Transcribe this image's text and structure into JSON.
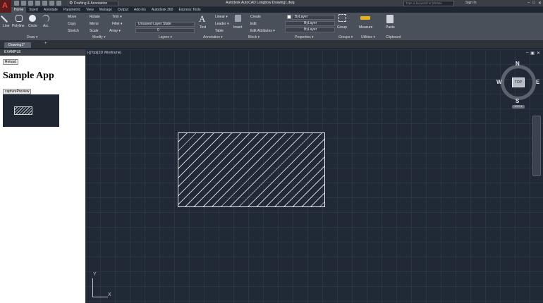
{
  "title_bar": {
    "workspace": "Drafting & Annotation",
    "title": "Autodesk AutoCAD Longbow   Drawing1.dwg",
    "search_placeholder": "Type a keyword or phrase",
    "sign_in": "Sign In"
  },
  "ribbon_tabs": [
    "Home",
    "Insert",
    "Annotate",
    "Parametric",
    "View",
    "Manage",
    "Output",
    "Add-ins",
    "Autodesk 360",
    "Express Tools"
  ],
  "ribbon": {
    "draw": {
      "line": "Line",
      "polyline": "Polyline",
      "circle": "Circle",
      "arc": "Arc",
      "panel": "Draw ▾"
    },
    "modify": {
      "move": "Move",
      "rotate": "Rotate",
      "trim": "Trim ▾",
      "copy": "Copy",
      "mirror": "Mirror",
      "fillet": "Fillet ▾",
      "stretch": "Stretch",
      "scale": "Scale",
      "array": "Array ▾",
      "panel": "Modify ▾"
    },
    "layers": {
      "layer_state": "Unsaved Layer State",
      "current_layer": "0",
      "panel": "Layers ▾"
    },
    "annotation": {
      "text": "Text",
      "linear": "Linear ▾",
      "leader": "Leader ▾",
      "table": "Table",
      "panel": "Annotation ▾"
    },
    "block": {
      "insert": "Insert",
      "create": "Create",
      "edit": "Edit",
      "edit_attributes": "Edit Attributes ▾",
      "panel": "Block ▾"
    },
    "properties": {
      "color": "ByLayer",
      "linetype": "ByLayer",
      "lineweight": "ByLayer",
      "panel": "Properties ▾"
    },
    "groups": {
      "group": "Group",
      "panel": "Groups ▾"
    },
    "utilities": {
      "measure": "Measure",
      "panel": "Utilities ▾"
    },
    "clipboard": {
      "paste": "Paste",
      "panel": "Clipboard"
    }
  },
  "doc_tab": "Drawing1*",
  "palette": {
    "header": "EXAMPLE",
    "reload": "Reload",
    "title": "Sample App",
    "capture": "capturePreview"
  },
  "viewport": {
    "label": "[-][Top][2D Wireframe]",
    "cube_top": "TOP",
    "north": "N",
    "south": "S",
    "east": "E",
    "west": "W",
    "wcs": "WCS ▾",
    "ucs_x": "X",
    "ucs_y": "Y"
  }
}
